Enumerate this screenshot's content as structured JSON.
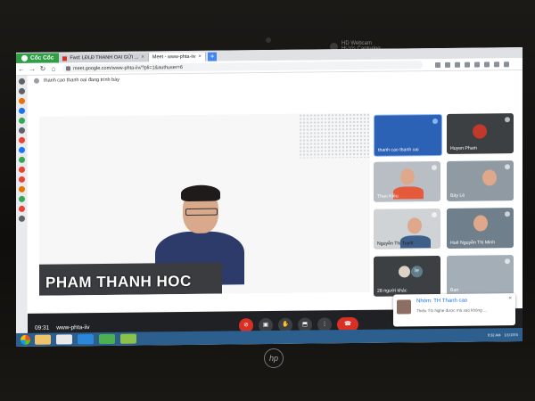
{
  "device": {
    "webcam_label": "HD Webcam",
    "webcam_sub": "Hi-Vis Capturing",
    "logo": "hp"
  },
  "browser": {
    "brand": "Cốc Cốc",
    "tabs": [
      {
        "label": "Fwd: LĐLĐ THANH OAI GỬI ...",
        "active": false
      },
      {
        "label": "Meet - www-phta-iiv",
        "active": true
      }
    ],
    "new_tab": "+",
    "url": "meet.google.com/www-phta-iiv/?pli=1&authuser=6"
  },
  "meet": {
    "presenting_text": "thanh cao thanh oai đang trình bày",
    "main_speaker_name": "PHAM THANH HOC",
    "tiles": [
      {
        "name": "thanh cao thanh oai",
        "active": true
      },
      {
        "name": "Huyen Pham"
      },
      {
        "name": "Thao Kiều"
      },
      {
        "name": "Bảy Lê"
      },
      {
        "name": "Nguyễn Thị Tuyết"
      },
      {
        "name": "Huế Nguyễn Thị Minh"
      },
      {
        "name": "28 người khác"
      },
      {
        "name": "Bạn"
      }
    ],
    "others_badge": "le",
    "time": "09:31",
    "meeting_code": "www-phta-iiv",
    "notification": {
      "title": "Nhóm: TH Thanh cao",
      "snippet": "Thiếu TG Nghe được mà sao không ...",
      "close": "×"
    },
    "controls": [
      "mic-off-icon",
      "camera-icon",
      "raise-hand-icon",
      "present-icon",
      "more-icon",
      "end-call-icon"
    ]
  },
  "taskbar": {
    "tray_time": "9:32 AM",
    "tray_date": "1/1/1970"
  }
}
